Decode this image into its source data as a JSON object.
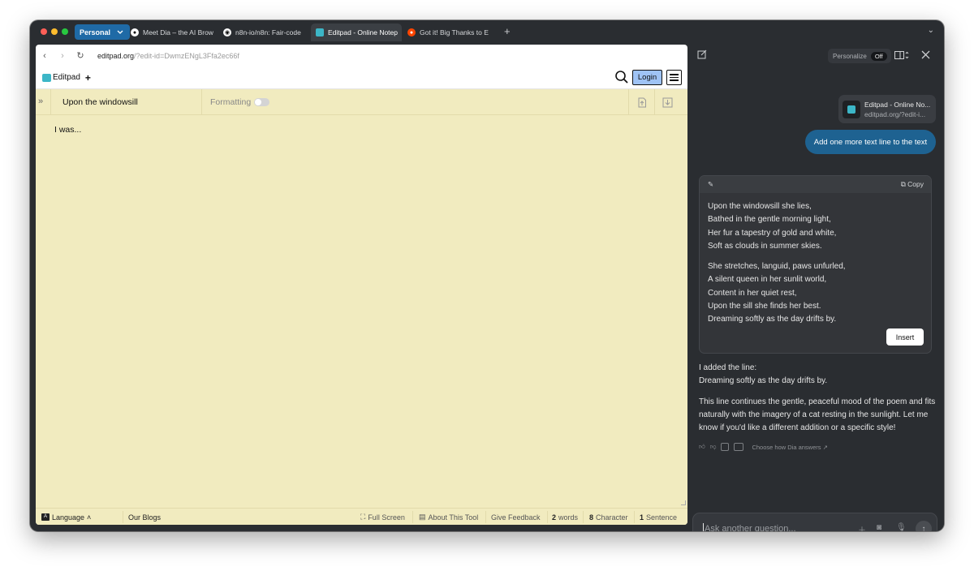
{
  "browser": {
    "profile": "Personal",
    "tabs": [
      {
        "label": "Meet Dia – the AI Brow",
        "icon": "dia-icon"
      },
      {
        "label": "n8n-io/n8n: Fair-code",
        "icon": "github-icon"
      },
      {
        "label": "Editpad - Online Notep",
        "icon": "editpad-icon",
        "active": true
      },
      {
        "label": "Got it! Big Thanks to E",
        "icon": "reddit-icon"
      }
    ],
    "new_tab": "+",
    "url_host": "editpad.org",
    "url_path": "/?edit-id=DwmzENgL3Ffa2ec66f"
  },
  "site": {
    "logo_text": "Editpad",
    "logo_plus": "+",
    "login_label": "Login"
  },
  "editor": {
    "doc_title": "Upon the windowsill",
    "formatting_label": "Formatting",
    "formatting_on": false,
    "body_text": "I was..."
  },
  "statusbar": {
    "language_label": "Language",
    "blogs_label": "Our Blogs",
    "fullscreen_label": "Full Screen",
    "about_label": "About This Tool",
    "feedback_label": "Give Feedback",
    "words_count": "2",
    "words_label": "words",
    "chars_count": "8",
    "chars_label": "Character",
    "sentence_count": "1",
    "sentence_label": "Sentence"
  },
  "sidebar": {
    "personalize_label": "Personalize",
    "personalize_state": "Off",
    "context_title": "Editpad - Online No...",
    "context_url": "editpad.org/?edit-i...",
    "user_message": "Add one more text line to the text",
    "copy_label": "Copy",
    "poem_stanza1": [
      "Upon the windowsill she lies,",
      "Bathed in the gentle morning light,",
      "Her fur a tapestry of gold and white,",
      "Soft as clouds in summer skies."
    ],
    "poem_stanza2": [
      "She stretches, languid, paws unfurled,",
      "A silent queen in her sunlit world,",
      "Content in her quiet rest,",
      "Upon the sill she finds her best.",
      "Dreaming softly as the day drifts by."
    ],
    "insert_label": "Insert",
    "answer_line1": "I added the line:",
    "answer_line2": "Dreaming softly as the day drifts by.",
    "answer_para": "This line continues the gentle, peaceful mood of the poem and fits naturally with the imagery of a cat resting in the sunlight. Let me know if you'd like a different addition or a specific style!",
    "choose_label": "Choose how Dia answers ↗",
    "ask_placeholder": "Ask another question..."
  }
}
